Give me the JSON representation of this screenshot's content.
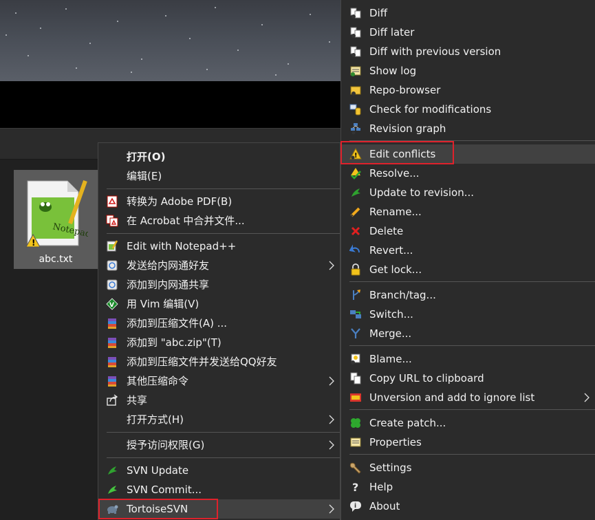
{
  "desktop": {
    "file_name": "abc.txt"
  },
  "context_menu": {
    "items": [
      {
        "label": "打开(O)"
      },
      {
        "label": "编辑(E)"
      },
      {
        "label": "转换为 Adobe PDF(B)"
      },
      {
        "label": "在 Acrobat 中合并文件..."
      },
      {
        "label": "Edit with Notepad++"
      },
      {
        "label": "发送给内网通好友"
      },
      {
        "label": "添加到内网通共享"
      },
      {
        "label": "用 Vim 编辑(V)"
      },
      {
        "label": "添加到压缩文件(A) ..."
      },
      {
        "label": "添加到 \"abc.zip\"(T)"
      },
      {
        "label": "添加到压缩文件并发送给QQ好友"
      },
      {
        "label": "其他压缩命令"
      },
      {
        "label": "共享"
      },
      {
        "label": "打开方式(H)"
      },
      {
        "label": "授予访问权限(G)"
      },
      {
        "label": "SVN Update"
      },
      {
        "label": "SVN Commit..."
      },
      {
        "label": "TortoiseSVN"
      }
    ]
  },
  "svn_menu": {
    "items": [
      {
        "label": "Diff"
      },
      {
        "label": "Diff later"
      },
      {
        "label": "Diff with previous version"
      },
      {
        "label": "Show log"
      },
      {
        "label": "Repo-browser"
      },
      {
        "label": "Check for modifications"
      },
      {
        "label": "Revision graph"
      },
      {
        "label": "Edit conflicts"
      },
      {
        "label": "Resolve..."
      },
      {
        "label": "Update to revision..."
      },
      {
        "label": "Rename..."
      },
      {
        "label": "Delete"
      },
      {
        "label": "Revert..."
      },
      {
        "label": "Get lock..."
      },
      {
        "label": "Branch/tag..."
      },
      {
        "label": "Switch..."
      },
      {
        "label": "Merge..."
      },
      {
        "label": "Blame..."
      },
      {
        "label": "Copy URL to clipboard"
      },
      {
        "label": "Unversion and add to ignore list"
      },
      {
        "label": "Create patch..."
      },
      {
        "label": "Properties"
      },
      {
        "label": "Settings"
      },
      {
        "label": "Help"
      },
      {
        "label": "About"
      }
    ]
  },
  "colors": {
    "menu_bg": "#2b2b2b",
    "hover_bg": "#414141",
    "highlight_border": "#e0212b"
  }
}
